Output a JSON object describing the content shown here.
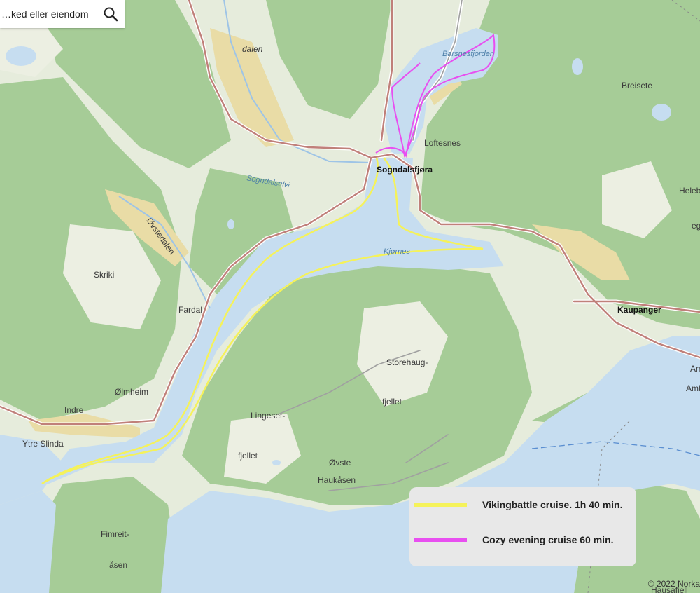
{
  "search": {
    "placeholder": "ked eller eiendom…"
  },
  "map": {
    "place_labels": [
      "dalen",
      "Breisete",
      "Loftesnes",
      "Sogndalsfjøra",
      "Heleb",
      "eg",
      "Skriki",
      "Øvstedalen",
      "Fardal",
      "Kaupanger",
      "Storehaug-",
      "fjellet",
      "Ølmheim",
      "Indre",
      "Ytre Slinda",
      "Lingeset-",
      "fjellet",
      "Øvste",
      "Haukåsen",
      "Fimreit-",
      "åsen",
      "Am",
      "Amb",
      "Hausafjell"
    ],
    "water_labels": [
      "Barsnesfjorden",
      "Sogndalselvi",
      "Kjørnes"
    ]
  },
  "legend": {
    "items": [
      {
        "label": "Vikingbattle cruise. 1h 40 min.",
        "color": "#f5f25a"
      },
      {
        "label": "Cozy evening cruise 60 min.",
        "color": "#e84ff0"
      }
    ]
  },
  "attribution": "© 2022 Norka",
  "colors": {
    "water": "#c6ddf0",
    "forest": "#a9cf9a",
    "land": "#e3ead9",
    "road": "#c0807a"
  }
}
